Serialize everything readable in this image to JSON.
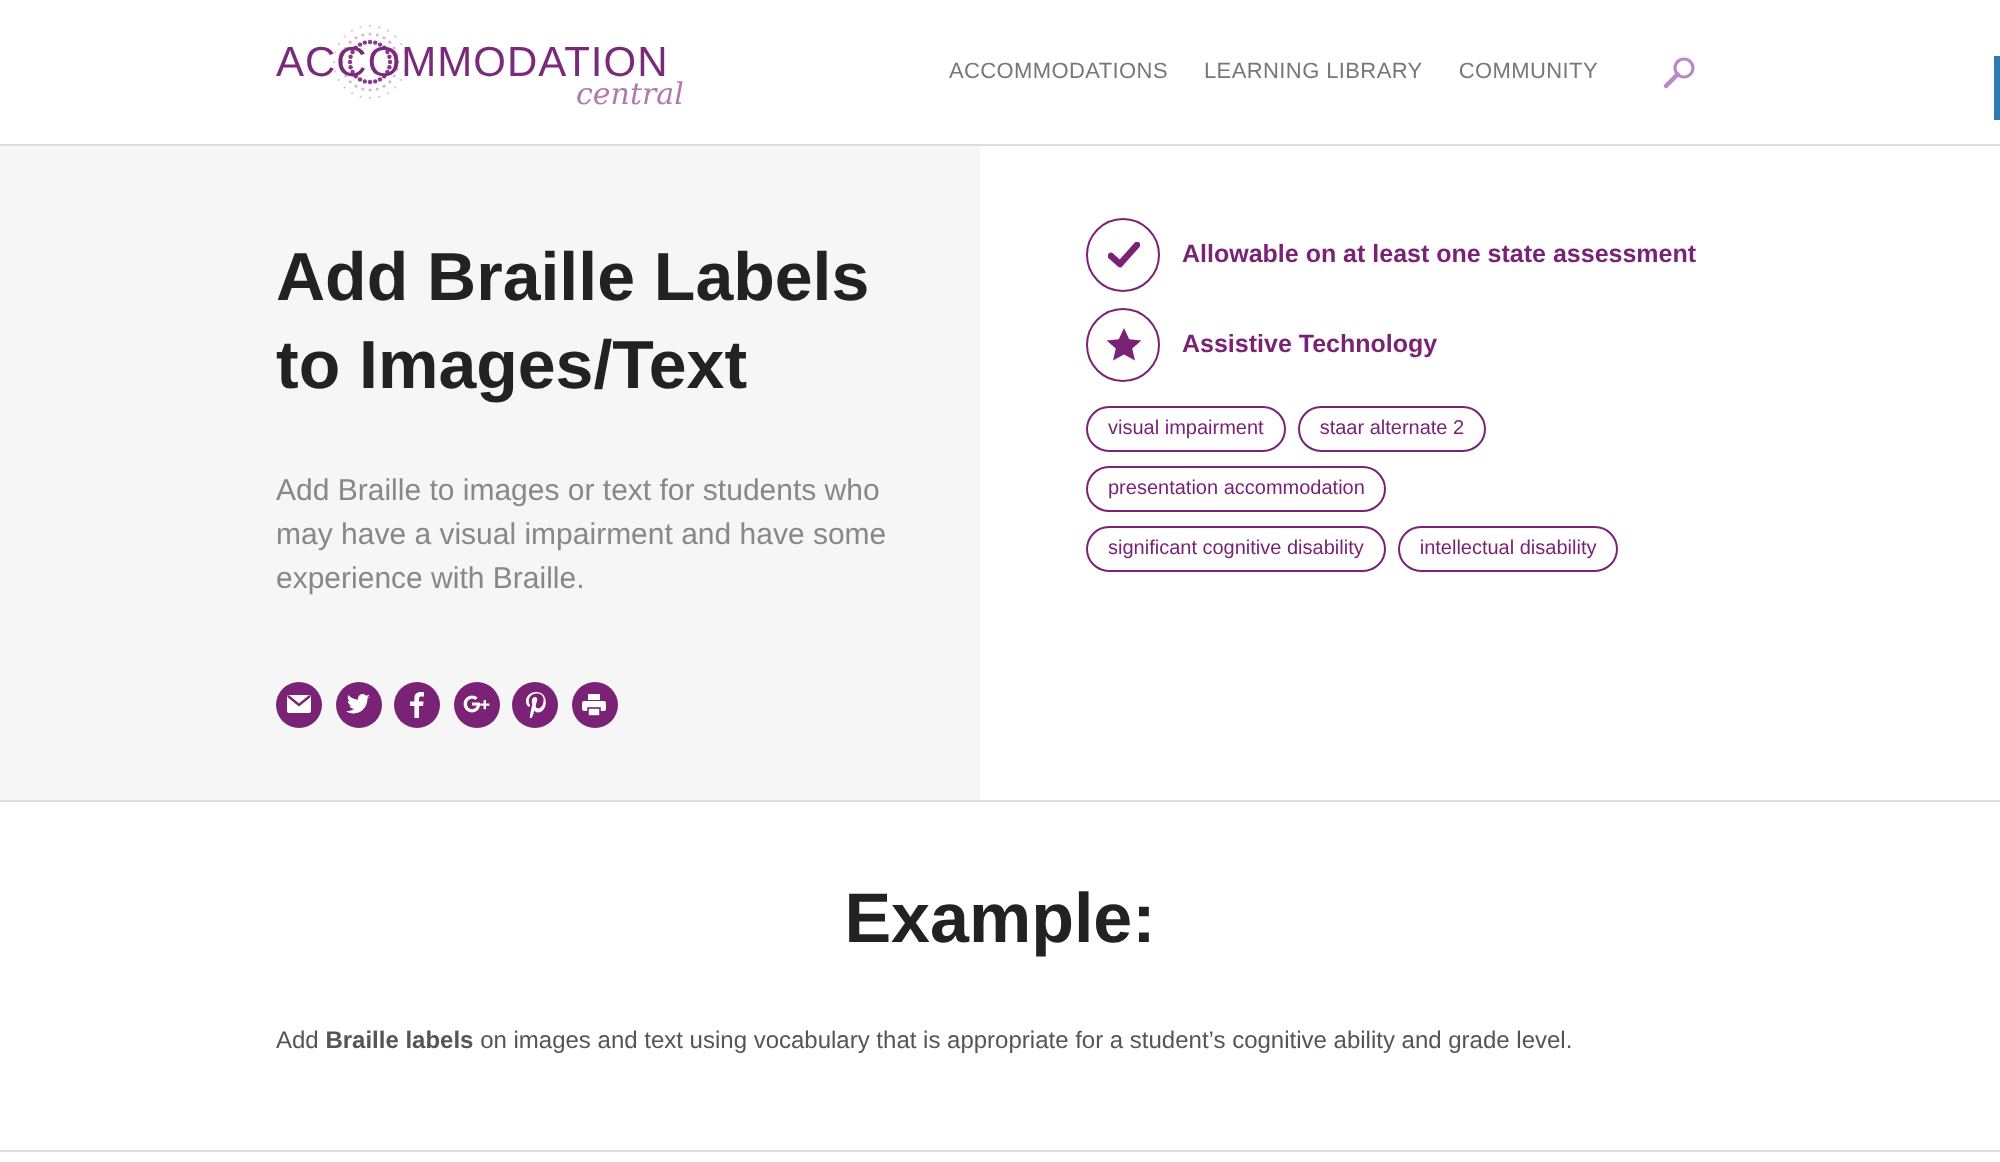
{
  "header": {
    "logo": {
      "word": "ACCOMMODATION",
      "sub": "central"
    },
    "nav": [
      {
        "label": "ACCOMMODATIONS"
      },
      {
        "label": "LEARNING LIBRARY"
      },
      {
        "label": "COMMUNITY"
      }
    ]
  },
  "hero": {
    "title": "Add Braille Labels to Images/Text",
    "description": "Add Braille to images or text for students who may have a visual impairment and have some experience with Braille.",
    "share": [
      {
        "kind": "email"
      },
      {
        "kind": "twitter"
      },
      {
        "kind": "facebook"
      },
      {
        "kind": "googleplus"
      },
      {
        "kind": "pinterest"
      },
      {
        "kind": "print"
      }
    ],
    "features": [
      {
        "kind": "check",
        "label": "Allowable on at least one state assessment"
      },
      {
        "kind": "star",
        "label": "Assistive Technology"
      }
    ],
    "tags": [
      [
        "visual impairment",
        "staar alternate 2"
      ],
      [
        "presentation accommodation"
      ],
      [
        "significant cognitive disability",
        "intellectual disability"
      ]
    ]
  },
  "example": {
    "heading": "Example:",
    "text": "Add **Braille labels** on images and text using vocabulary that is appropriate for a student’s cognitive ability and grade level."
  }
}
